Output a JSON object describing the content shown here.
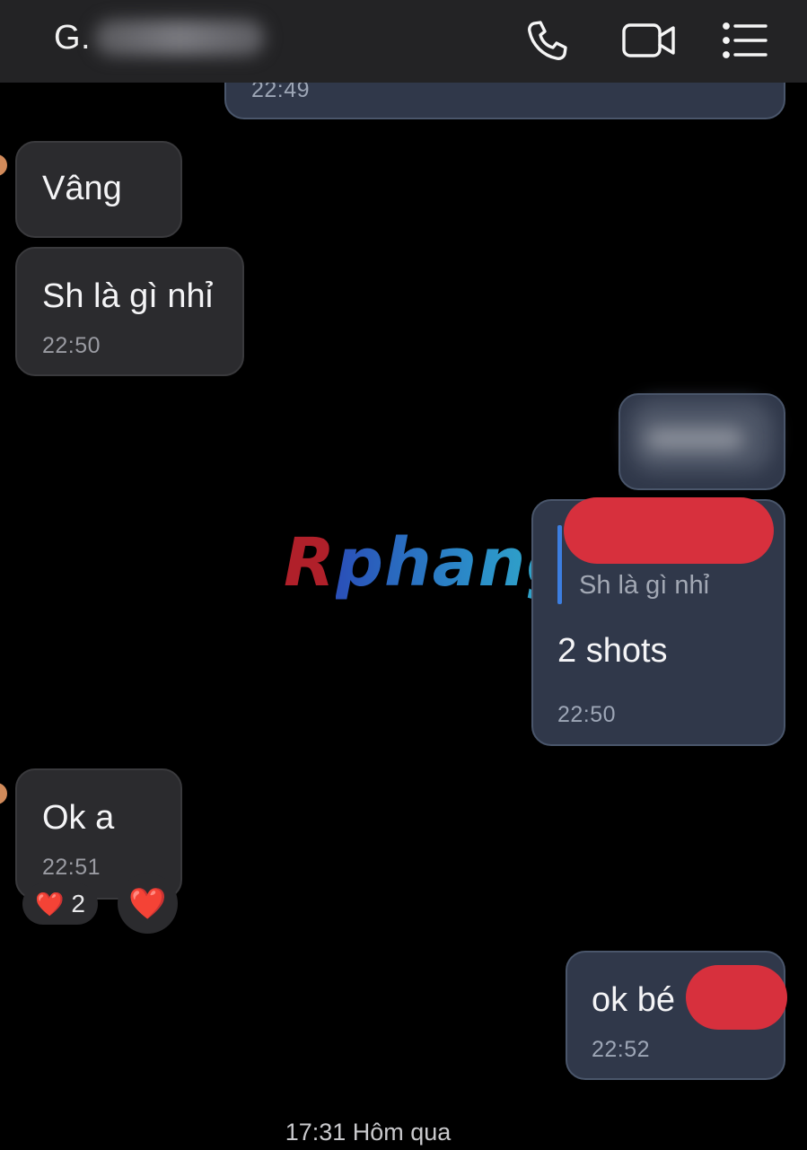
{
  "header": {
    "contact_name_visible": "G.",
    "call_icon": "phone-icon",
    "video_icon": "video-camera-icon",
    "menu_icon": "list-menu-icon",
    "background": "#232325"
  },
  "messages": [
    {
      "direction": "outgoing",
      "text": "",
      "time": "22:49"
    },
    {
      "direction": "incoming",
      "text": "Vâng",
      "time": ""
    },
    {
      "direction": "incoming",
      "text": "Sh là gì nhỉ",
      "time": "22:50"
    },
    {
      "direction": "outgoing",
      "text": "",
      "time": ""
    },
    {
      "direction": "outgoing",
      "quote": "Sh là gì nhỉ",
      "text": "2 shots",
      "time": "22:50"
    },
    {
      "direction": "incoming",
      "text": "Ok a",
      "time": "22:51",
      "reactions": {
        "emoji": "❤️",
        "count": "2"
      },
      "react_button": "❤️"
    },
    {
      "direction": "outgoing",
      "text": "ok bé",
      "time": "22:52"
    }
  ],
  "watermark": {
    "first": "R",
    "rest": "phang"
  },
  "footer": {
    "timestamp": "17:31 Hôm qua"
  },
  "colors": {
    "incoming_bubble": "#2b2b2e",
    "outgoing_bubble": "#30384a",
    "quote_bar": "#3c7ee0",
    "redaction": "#d7303d"
  }
}
